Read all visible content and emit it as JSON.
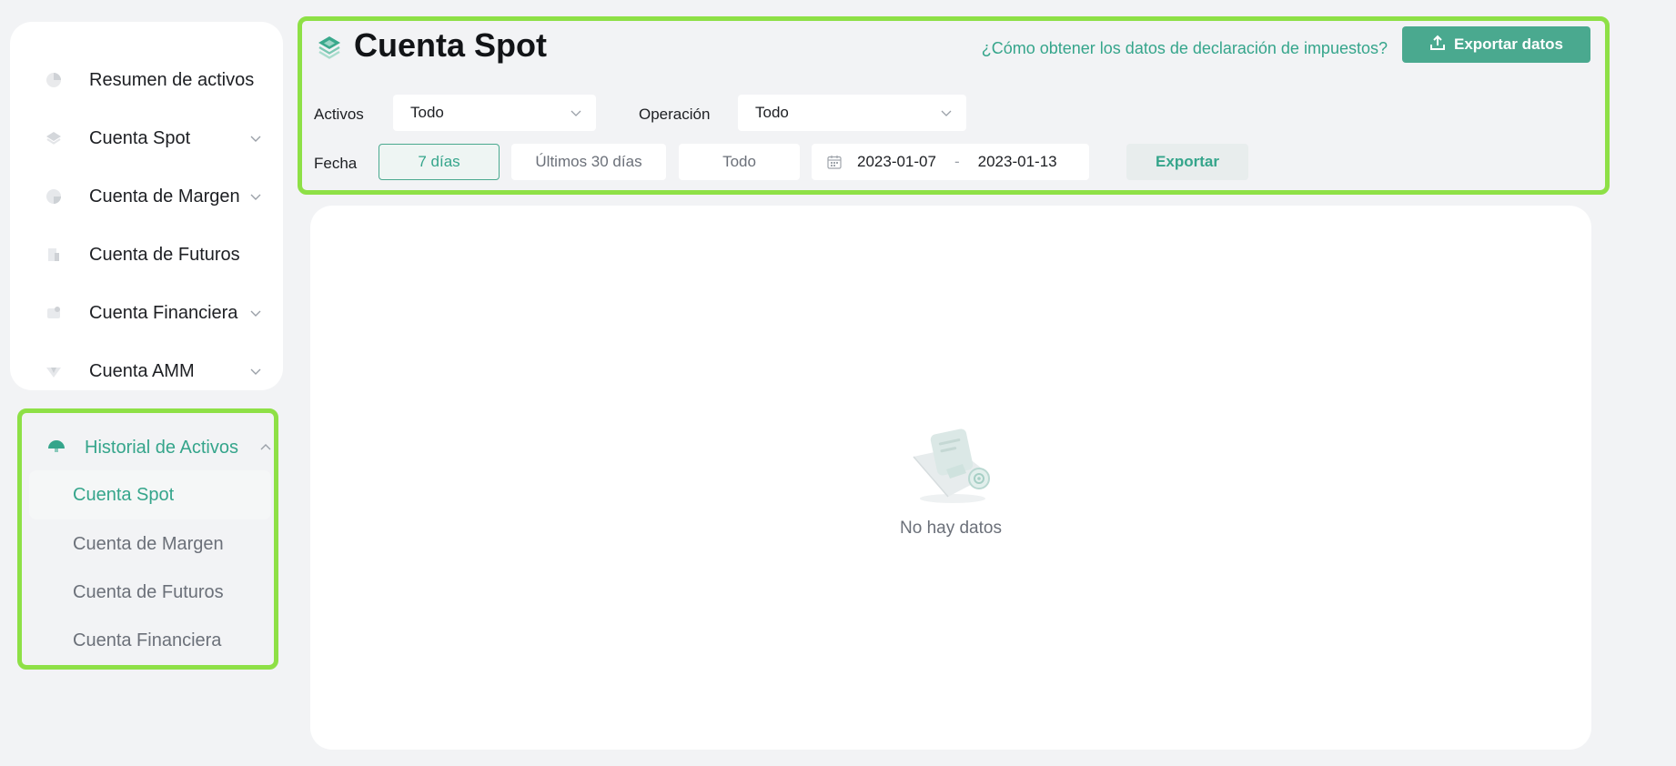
{
  "sidebar": {
    "items": [
      {
        "label": "Resumen de activos",
        "icon": "pie-chart-icon",
        "has_chevron": false
      },
      {
        "label": "Cuenta Spot",
        "icon": "layers-icon",
        "has_chevron": true
      },
      {
        "label": "Cuenta de Margen",
        "icon": "circle-half-icon",
        "has_chevron": true
      },
      {
        "label": "Cuenta de Futuros",
        "icon": "document-icon",
        "has_chevron": false
      },
      {
        "label": "Cuenta Financiera",
        "icon": "wallet-icon",
        "has_chevron": true
      },
      {
        "label": "Cuenta AMM",
        "icon": "diamond-icon",
        "has_chevron": true
      }
    ],
    "history": {
      "label": "Historial de Activos",
      "icon": "history-icon",
      "expanded": true,
      "items": [
        {
          "label": "Cuenta Spot",
          "active": true
        },
        {
          "label": "Cuenta de Margen",
          "active": false
        },
        {
          "label": "Cuenta de Futuros",
          "active": false
        },
        {
          "label": "Cuenta Financiera",
          "active": false
        }
      ]
    }
  },
  "header": {
    "title": "Cuenta Spot",
    "tax_link": "¿Cómo obtener los datos de declaración de impuestos?",
    "export_data_label": "Exportar datos"
  },
  "filters": {
    "assets_label": "Activos",
    "assets_value": "Todo",
    "operation_label": "Operación",
    "operation_value": "Todo",
    "date_label": "Fecha",
    "date_options": [
      {
        "label": "7 días",
        "active": true
      },
      {
        "label": "Últimos 30 días",
        "active": false
      },
      {
        "label": "Todo",
        "active": false
      }
    ],
    "date_from": "2023-01-07",
    "date_separator": "-",
    "date_to": "2023-01-13",
    "export_label": "Exportar"
  },
  "content": {
    "empty_text": "No hay datos"
  },
  "colors": {
    "accent": "#35a58b",
    "button": "#4aa98f",
    "highlight_border": "#8ee046",
    "background": "#f2f3f5"
  }
}
